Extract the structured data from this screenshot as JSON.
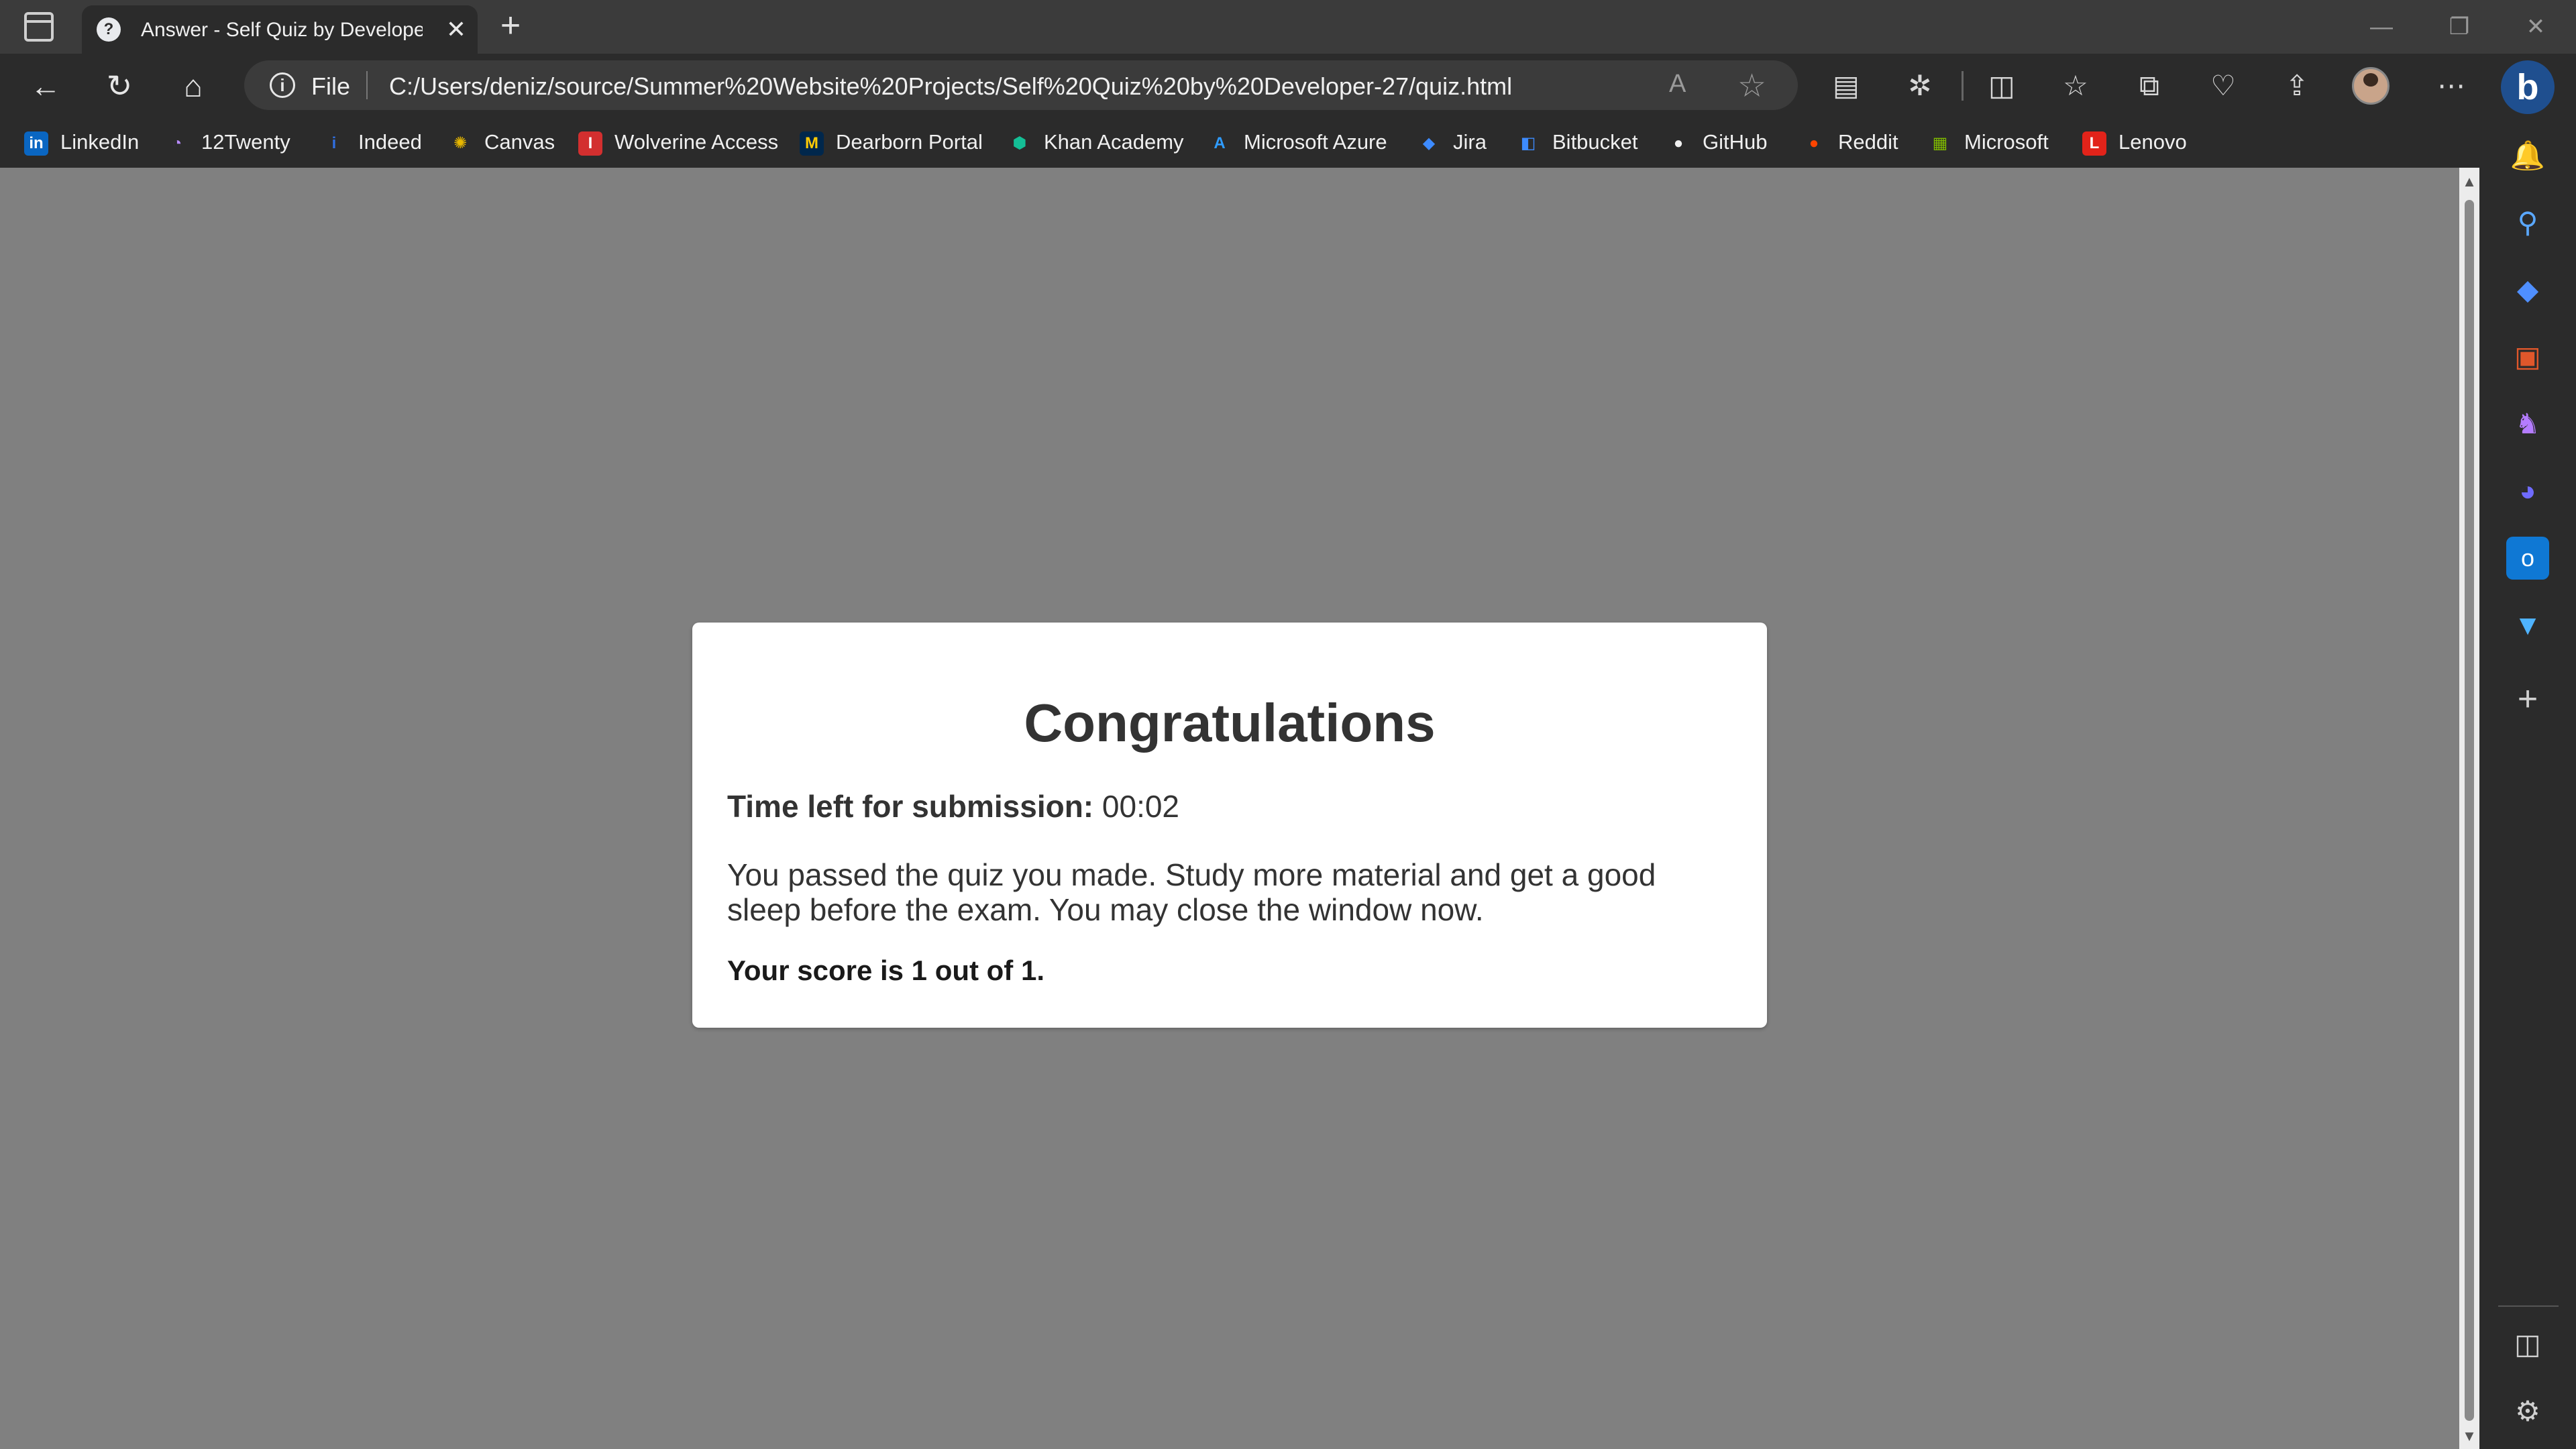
{
  "browser": {
    "tab": {
      "title": "Answer - Self Quiz by Developer",
      "close_glyph": "✕"
    },
    "new_tab_glyph": "+",
    "window_controls": {
      "minimize": "—",
      "maximize": "❐",
      "close": "✕"
    },
    "toolbar": {
      "back_glyph": "←",
      "reload_glyph": "↻",
      "home_glyph": "⌂",
      "info_glyph": "i",
      "protocol_label": "File",
      "url": "C:/Users/deniz/source/Summer%20Website%20Projects/Self%20Quiz%20by%20Developer-27/quiz.html",
      "read_aloud_glyph": "A",
      "favorite_glyph": "☆",
      "more_glyph": "⋯",
      "bing_glyph": "b"
    },
    "favorites": [
      {
        "label": "LinkedIn",
        "icon": "in",
        "color": "#0a66c2"
      },
      {
        "label": "12Twenty",
        "icon": "◔",
        "color": "#7b3fe4"
      },
      {
        "label": "Indeed",
        "icon": "i",
        "color": "#2557a7"
      },
      {
        "label": "Canvas",
        "icon": "✺",
        "color": "#d6a600"
      },
      {
        "label": "Wolverine Access",
        "icon": "I",
        "color": "#d32f2f"
      },
      {
        "label": "Dearborn Portal",
        "icon": "M",
        "color": "#00274c"
      },
      {
        "label": "Khan Academy",
        "icon": "⬢",
        "color": "#14bf96"
      },
      {
        "label": "Microsoft Azure",
        "icon": "A",
        "color": "#0078d4"
      },
      {
        "label": "Jira",
        "icon": "◆",
        "color": "#2684ff"
      },
      {
        "label": "Bitbucket",
        "icon": "◧",
        "color": "#2684ff"
      },
      {
        "label": "GitHub",
        "icon": "●",
        "color": "#f0f0f0"
      },
      {
        "label": "Reddit",
        "icon": "●",
        "color": "#ff4500"
      },
      {
        "label": "Microsoft",
        "icon": "▦",
        "color": "#f25022"
      },
      {
        "label": "Lenovo",
        "icon": "L",
        "color": "#e2231a"
      }
    ]
  },
  "quiz": {
    "title": "Congratulations",
    "timer_label": "Time left for submission:",
    "timer_value": "00:02",
    "message": "You passed the quiz you made. Study more material and get a good sleep before the exam. You may close the window now.",
    "score": "Your score is 1 out of 1."
  },
  "sidebar": {
    "icons": [
      {
        "name": "notifications-icon",
        "glyph": "🔔",
        "color": "#3aa0ff"
      },
      {
        "name": "search-icon",
        "glyph": "⚲",
        "color": "#5aa8ff"
      },
      {
        "name": "shopping-icon",
        "glyph": "◆",
        "color": "#4f8fff"
      },
      {
        "name": "tools-icon",
        "glyph": "▣",
        "color": "#e0572b"
      },
      {
        "name": "games-icon",
        "glyph": "♞",
        "color": "#b47cff"
      },
      {
        "name": "microsoft365-icon",
        "glyph": "◕",
        "color": "#6f6bff"
      },
      {
        "name": "outlook-icon",
        "glyph": "o",
        "color": "#0f78d4"
      },
      {
        "name": "drop-icon",
        "glyph": "▼",
        "color": "#4fb3ff"
      }
    ],
    "add_glyph": "+",
    "split_glyph": "◫",
    "settings_glyph": "⚙"
  }
}
